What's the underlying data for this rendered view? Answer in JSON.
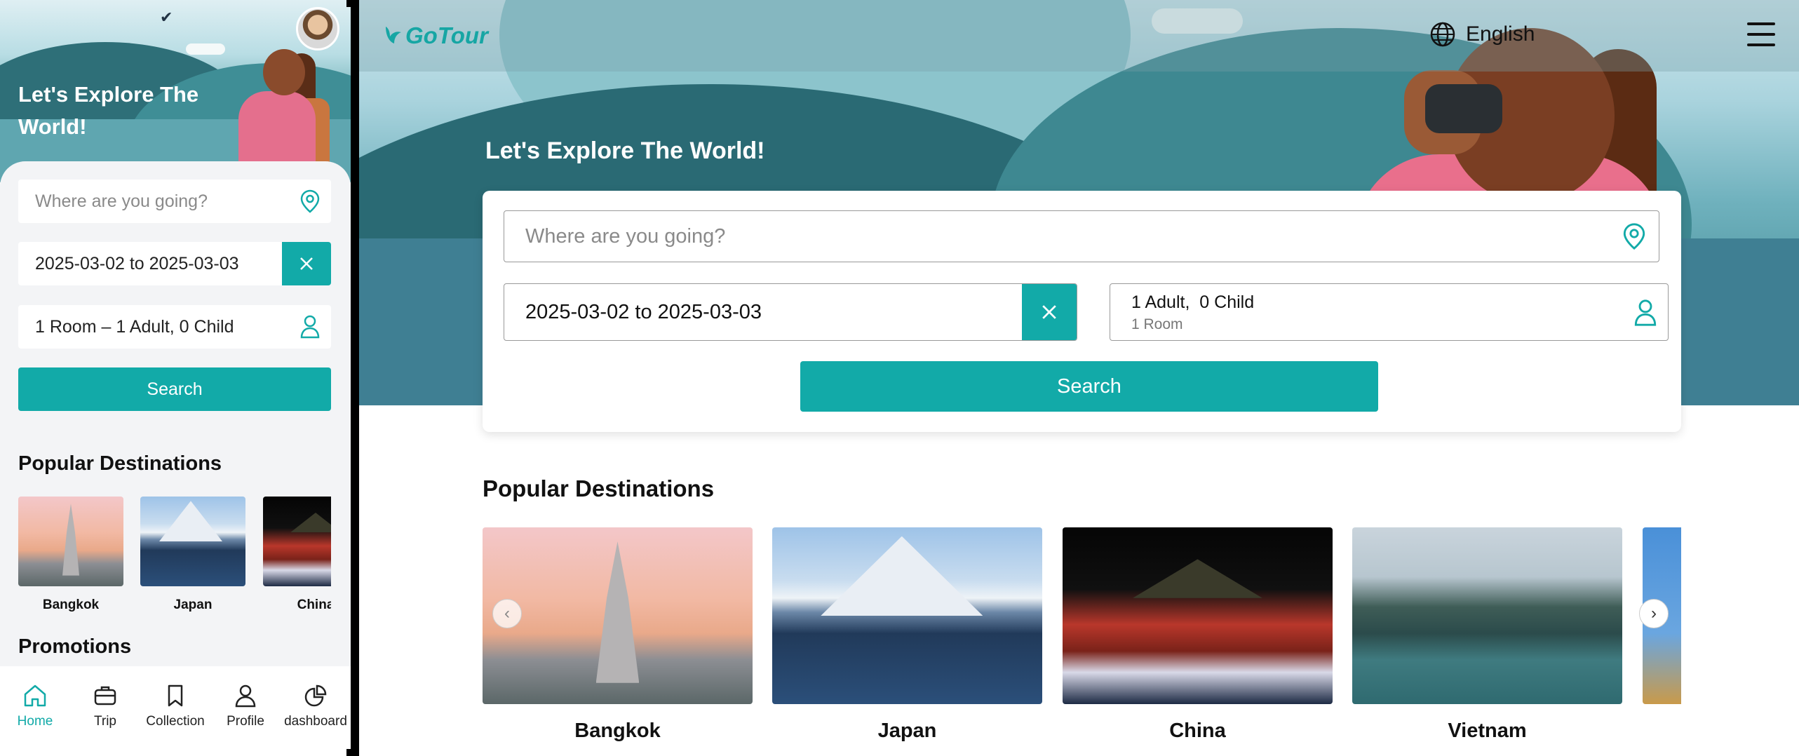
{
  "mobile": {
    "title": "Let's Explore The World!",
    "where_placeholder": "Where are you going?",
    "dates": "2025-03-02 to 2025-03-03",
    "guests": "1 Room – 1 Adult, 0 Child",
    "search_label": "Search",
    "popular_heading": "Popular Destinations",
    "destinations": [
      {
        "label": "Bangkok"
      },
      {
        "label": "Japan"
      },
      {
        "label": "China"
      }
    ],
    "promotions_heading": "Promotions",
    "nav": [
      {
        "label": "Home",
        "icon": "home-icon",
        "active": true
      },
      {
        "label": "Trip",
        "icon": "briefcase-icon",
        "active": false
      },
      {
        "label": "Collection",
        "icon": "bookmark-icon",
        "active": false
      },
      {
        "label": "Profile",
        "icon": "user-icon",
        "active": false
      },
      {
        "label": "dashboard",
        "icon": "pie-chart-icon",
        "active": false
      }
    ]
  },
  "desktop": {
    "logo": "GoTour",
    "language": "English",
    "title": "Let's Explore The World!",
    "where_placeholder": "Where are you going?",
    "dates": "2025-03-02 to 2025-03-03",
    "guests_primary": "1 Adult,  0 Child",
    "guests_secondary": "1 Room",
    "search_label": "Search",
    "popular_heading": "Popular Destinations",
    "destinations": [
      {
        "label": "Bangkok"
      },
      {
        "label": "Japan"
      },
      {
        "label": "China"
      },
      {
        "label": "Vietnam"
      }
    ],
    "prev_arrow": "‹",
    "next_arrow": "›"
  },
  "colors": {
    "accent": "#12aaa8",
    "text": "#111111"
  }
}
